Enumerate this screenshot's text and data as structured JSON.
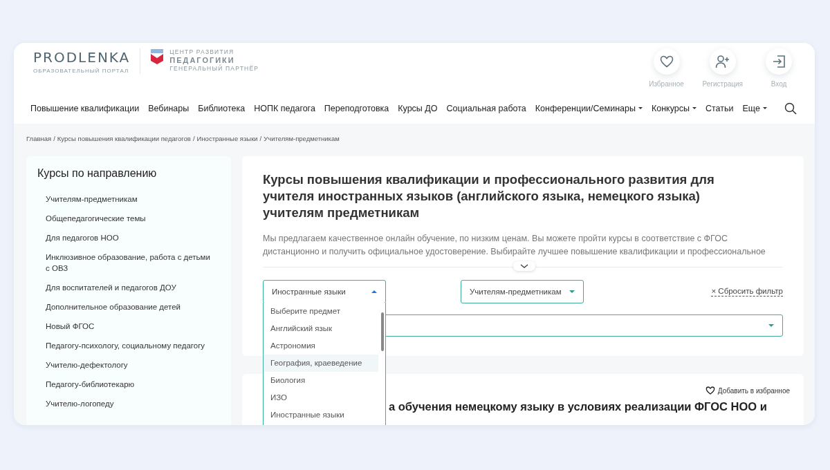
{
  "header": {
    "logo": {
      "name": "PRODLENKA",
      "tagline": "ОБРАЗОВАТЕЛЬНЫЙ ПОРТАЛ"
    },
    "partner": {
      "line1": "ЦЕНТР РАЗВИТИЯ",
      "line2": "ПЕДАГОГИКИ",
      "caption": "ГЕНЕРАЛЬНЫЙ ПАРТНЁР"
    },
    "actions": [
      {
        "kind": "favorites",
        "label": "Избранное"
      },
      {
        "kind": "register",
        "label": "Регистрация"
      },
      {
        "kind": "login",
        "label": "Вход"
      }
    ],
    "nav": [
      {
        "label": "Повышение квалификации",
        "dropdown": false
      },
      {
        "label": "Вебинары",
        "dropdown": false
      },
      {
        "label": "Библиотека",
        "dropdown": false
      },
      {
        "label": "НОПК педагога",
        "dropdown": false
      },
      {
        "label": "Переподготовка",
        "dropdown": false
      },
      {
        "label": "Курсы ДО",
        "dropdown": false
      },
      {
        "label": "Социальная работа",
        "dropdown": false
      },
      {
        "label": "Конференции/Семинары",
        "dropdown": true
      },
      {
        "label": "Конкурсы",
        "dropdown": true
      },
      {
        "label": "Статьи",
        "dropdown": false
      },
      {
        "label": "Еще",
        "dropdown": true
      }
    ]
  },
  "breadcrumbs": {
    "separator": "/",
    "items": [
      "Главная",
      "Курсы повышения квалификации педагогов",
      "Иностранные языки",
      "Учителям-предметникам"
    ]
  },
  "sidebar": {
    "title": "Курсы по направлению",
    "items": [
      "Учителям-предметникам",
      "Общепедагогические темы",
      "Для педагогов НОО",
      "Инклюзивное образование, работа с детьми с ОВЗ",
      "Для воспитателей и педагогов ДОУ",
      "Дополнительное образование детей",
      "Новый ФГОС",
      "Педагогу-психологу, социальному педагогу",
      "Учителю-дефектологу",
      "Педагогу-библиотекарю",
      "Учителю-логопеду"
    ]
  },
  "main": {
    "title": "Курсы повышения квалификации и профессионального развития для учителя иностранных языков (английского языка, немецкого языка) учителям предметникам",
    "description": "Мы предлагаем качественное онлайн обучение, по низким ценам. Вы можете пройти курсы в соответствие с ФГОС дистанционно и получить официальное удостоверение. Выбирайте лучшее повышение квалификации и профессиональное",
    "subject_select": {
      "value": "Иностранные языки",
      "open": true,
      "options": [
        {
          "label": "Выберите предмет",
          "highlighted": false
        },
        {
          "label": "Английский язык",
          "highlighted": false
        },
        {
          "label": "Астрономия",
          "highlighted": false
        },
        {
          "label": "География, краеведение",
          "highlighted": true
        },
        {
          "label": "Биология",
          "highlighted": false
        },
        {
          "label": "ИЗО",
          "highlighted": false
        },
        {
          "label": "Иностранные языки",
          "highlighted": false
        }
      ]
    },
    "audience_select": {
      "value": "Учителям-предметникам",
      "open": false
    },
    "reset": "× Сбросить фильтр"
  },
  "course": {
    "favorite": "Добавить в избранное",
    "title": "а обучения немецкому языку в условиях реализации ФГОС НОО и"
  }
}
